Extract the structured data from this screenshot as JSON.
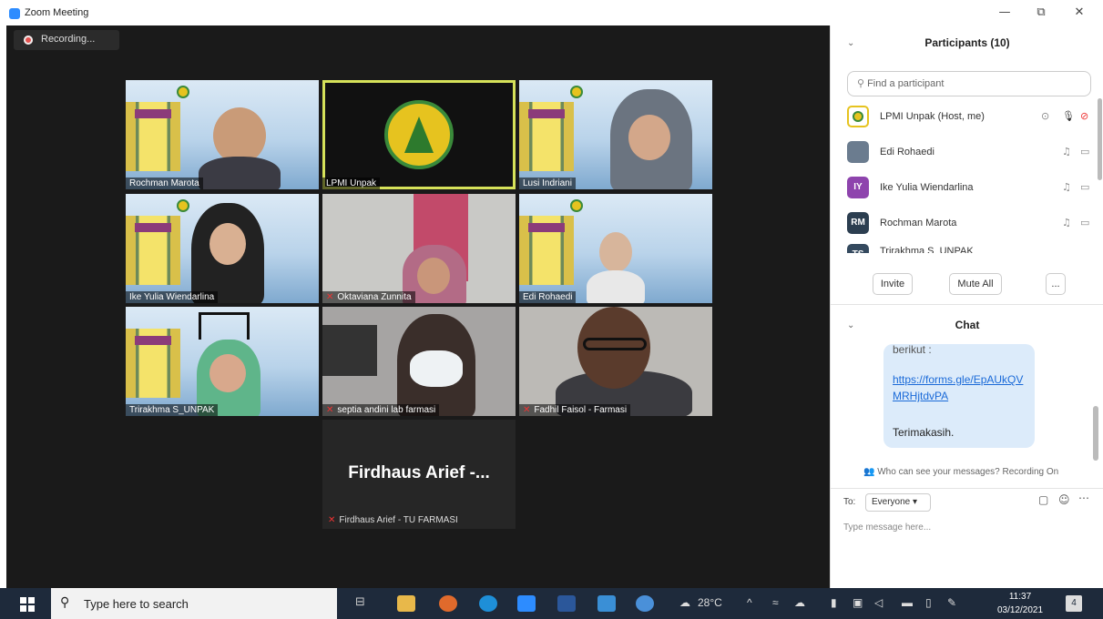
{
  "window": {
    "title": "Zoom Meeting",
    "minimize": "—",
    "restore": "⧉",
    "close": "✕"
  },
  "recording": {
    "label": "Recording..."
  },
  "tiles": [
    {
      "name": "Rochman Marota",
      "muted": false
    },
    {
      "name": "LPMI Unpak",
      "muted": false,
      "active": true
    },
    {
      "name": "Lusi Indriani",
      "muted": false
    },
    {
      "name": "Ike Yulia Wiendarlina",
      "muted": false
    },
    {
      "name": "Oktaviana Zunnita",
      "muted": true
    },
    {
      "name": "Edi Rohaedi",
      "muted": false
    },
    {
      "name": "Trirakhma S_UNPAK",
      "muted": false
    },
    {
      "name": "septia andini lab farmasi",
      "muted": true
    },
    {
      "name": "Fadhil Faisol - Farmasi",
      "muted": true
    }
  ],
  "big_tile": {
    "display": "Firdhaus Arief -...",
    "name": "Firdhaus Arief - TU FARMASI"
  },
  "participants": {
    "header": "Participants (10)",
    "search_placeholder": "Find a participant",
    "rows": [
      {
        "name": "LPMI Unpak (Host, me)",
        "initials": "",
        "color": "#e6c31f"
      },
      {
        "name": "Edi Rohaedi",
        "initials": "",
        "color": "#6b7c8f"
      },
      {
        "name": "Ike Yulia Wiendarlina",
        "initials": "IY",
        "color": "#8e44ad"
      },
      {
        "name": "Rochman Marota",
        "initials": "RM",
        "color": "#2c3e50"
      },
      {
        "name": "Trirakhma S_UNPAK",
        "initials": "TS",
        "color": "#34495e"
      }
    ],
    "invite": "Invite",
    "mute_all": "Mute All",
    "more": "..."
  },
  "chat": {
    "header": "Chat",
    "bubble_top": "berikut :",
    "link": "https://forms.gle/EpAUkQVMRHjtdvPA",
    "bubble_bottom": "Terimakasih.",
    "who_can_see": "Who can see your messages? Recording On",
    "to_label": "To:",
    "to_value": "Everyone ▾",
    "placeholder": "Type message here..."
  },
  "taskbar": {
    "search": "Type here to search",
    "weather": "28°C",
    "time": "11:37",
    "date": "03/12/2021",
    "notif_count": "4"
  }
}
